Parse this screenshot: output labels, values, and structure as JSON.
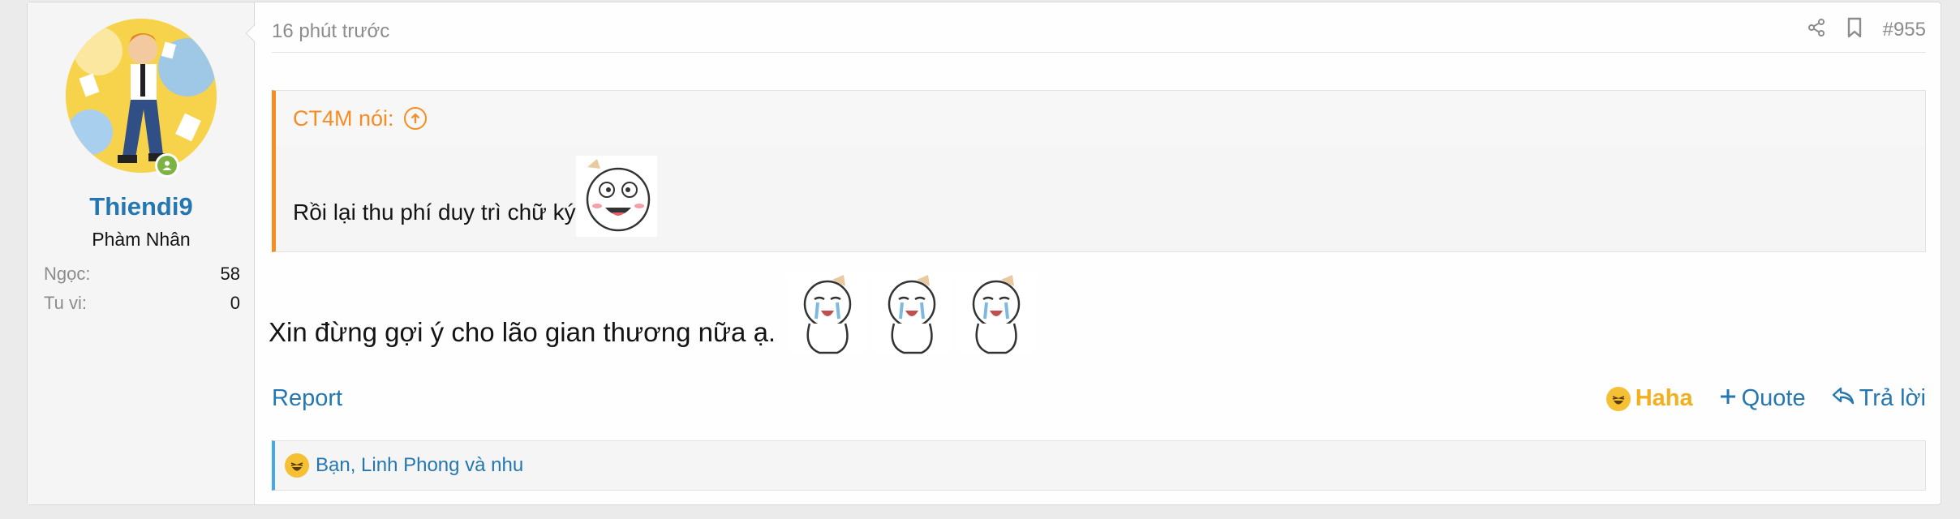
{
  "user": {
    "username": "Thiendi9",
    "title": "Phàm Nhân",
    "stats": [
      {
        "label": "Ngọc:",
        "value": "58"
      },
      {
        "label": "Tu vi:",
        "value": "0"
      }
    ]
  },
  "post": {
    "time": "16 phút trước",
    "number": "#955",
    "quote": {
      "author": "CT4M nói:",
      "text": "Rồi lại thu phí duy trì chữ ký"
    },
    "message": "Xin đừng gợi ý cho lão gian thương nữa ạ."
  },
  "actions": {
    "report": "Report",
    "haha": "Haha",
    "quote": "Quote",
    "reply": "Trả lời"
  },
  "reactions": {
    "summary": "Bạn, Linh Phong và nhu"
  },
  "colors": {
    "link": "#2577b1",
    "quote_accent": "#f78c22",
    "reaction_accent": "#47a7eb",
    "haha": "#f2b01e",
    "online": "#7cb342"
  }
}
